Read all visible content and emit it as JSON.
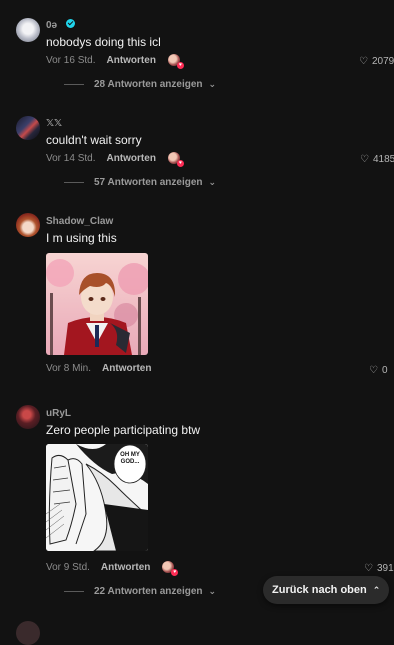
{
  "comments": [
    {
      "username": "0ə",
      "verified": true,
      "text": "nobodys doing this icl",
      "time": "Vor 16 Std.",
      "reply_label": "Antworten",
      "likes": "2079",
      "replies_label": "28 Antworten anzeigen"
    },
    {
      "username": "𝕏𝕏",
      "text": "couldn't wait sorry",
      "time": "Vor 14 Std.",
      "reply_label": "Antworten",
      "likes": "4185",
      "replies_label": "57 Antworten anzeigen"
    },
    {
      "username": "Shadow_Claw",
      "text": "I m using this",
      "time": "Vor 8 Min.",
      "reply_label": "Antworten",
      "likes": "0",
      "image": "anime-character-image"
    },
    {
      "username": "uRyL",
      "text": "Zero people participating btw",
      "time": "Vor 9 Std.",
      "reply_label": "Antworten",
      "likes": "391",
      "image": "manga-panel-image",
      "image_text": "OH MY GOD...",
      "replies_label": "22 Antworten anzeigen"
    }
  ],
  "back_to_top": "Zurück nach oben",
  "icons": {
    "like": "heart-icon",
    "expand": "chevron-down-icon",
    "back": "double-chevron-up-icon",
    "verified": "verified-badge-icon"
  },
  "colors": {
    "background": "#121212",
    "verified": "#20d5ec",
    "like_badge": "#fe2c55"
  }
}
